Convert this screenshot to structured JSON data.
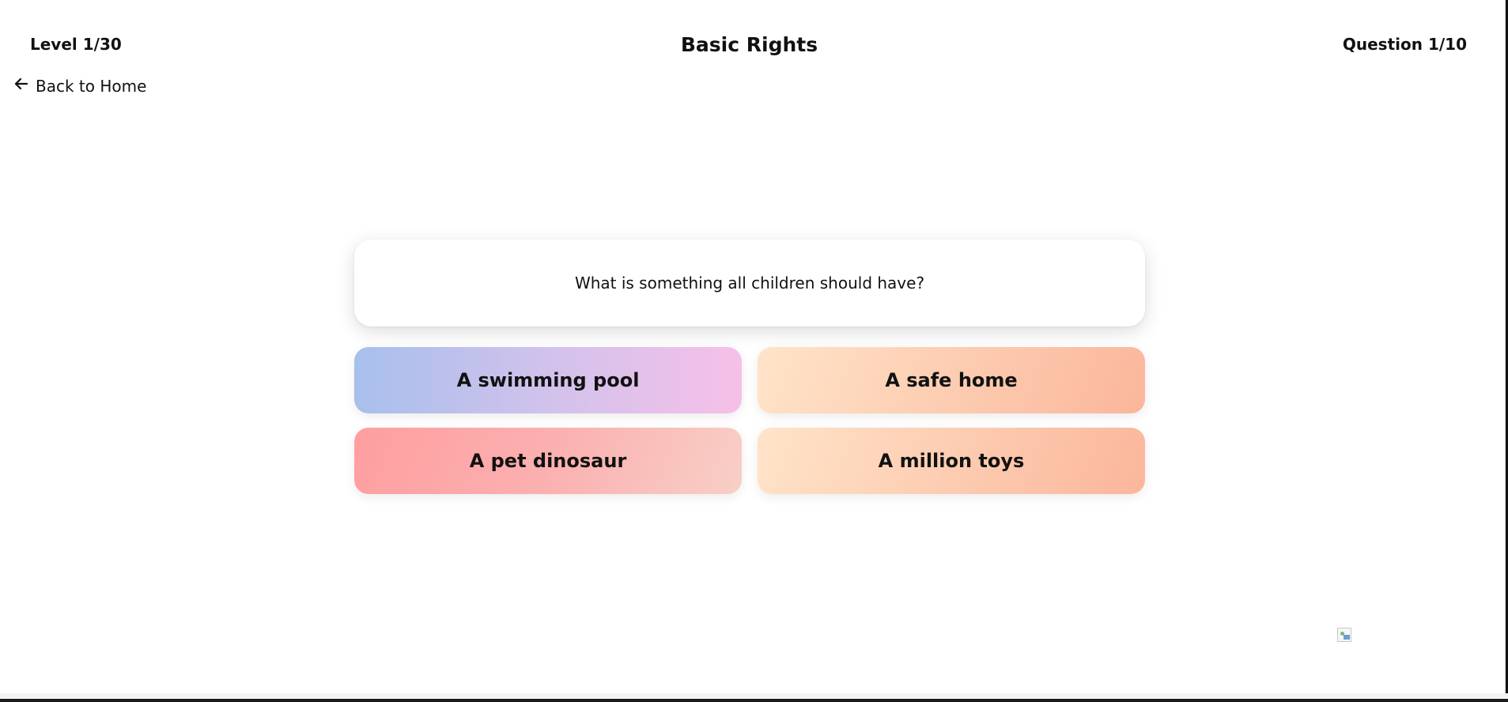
{
  "header": {
    "level": "Level 1/30",
    "title": "Basic Rights",
    "question_count": "Question 1/10"
  },
  "nav": {
    "back_label": "Back to Home",
    "back_icon": "arrow-left-icon"
  },
  "quiz": {
    "question": "What is something all children should have?",
    "answers": [
      {
        "label": "A swimming pool",
        "gradient": [
          "#a8bfec",
          "#f6c0e8"
        ]
      },
      {
        "label": "A safe home",
        "gradient": [
          "#ffe4c9",
          "#fbb69b"
        ]
      },
      {
        "label": "A pet dinosaur",
        "gradient": [
          "#ff9ea0",
          "#f8cfc6"
        ]
      },
      {
        "label": "A million toys",
        "gradient": [
          "#ffe4c9",
          "#fbb69b"
        ]
      }
    ]
  },
  "decor": {
    "broken_image_icon": "broken-image-icon"
  }
}
